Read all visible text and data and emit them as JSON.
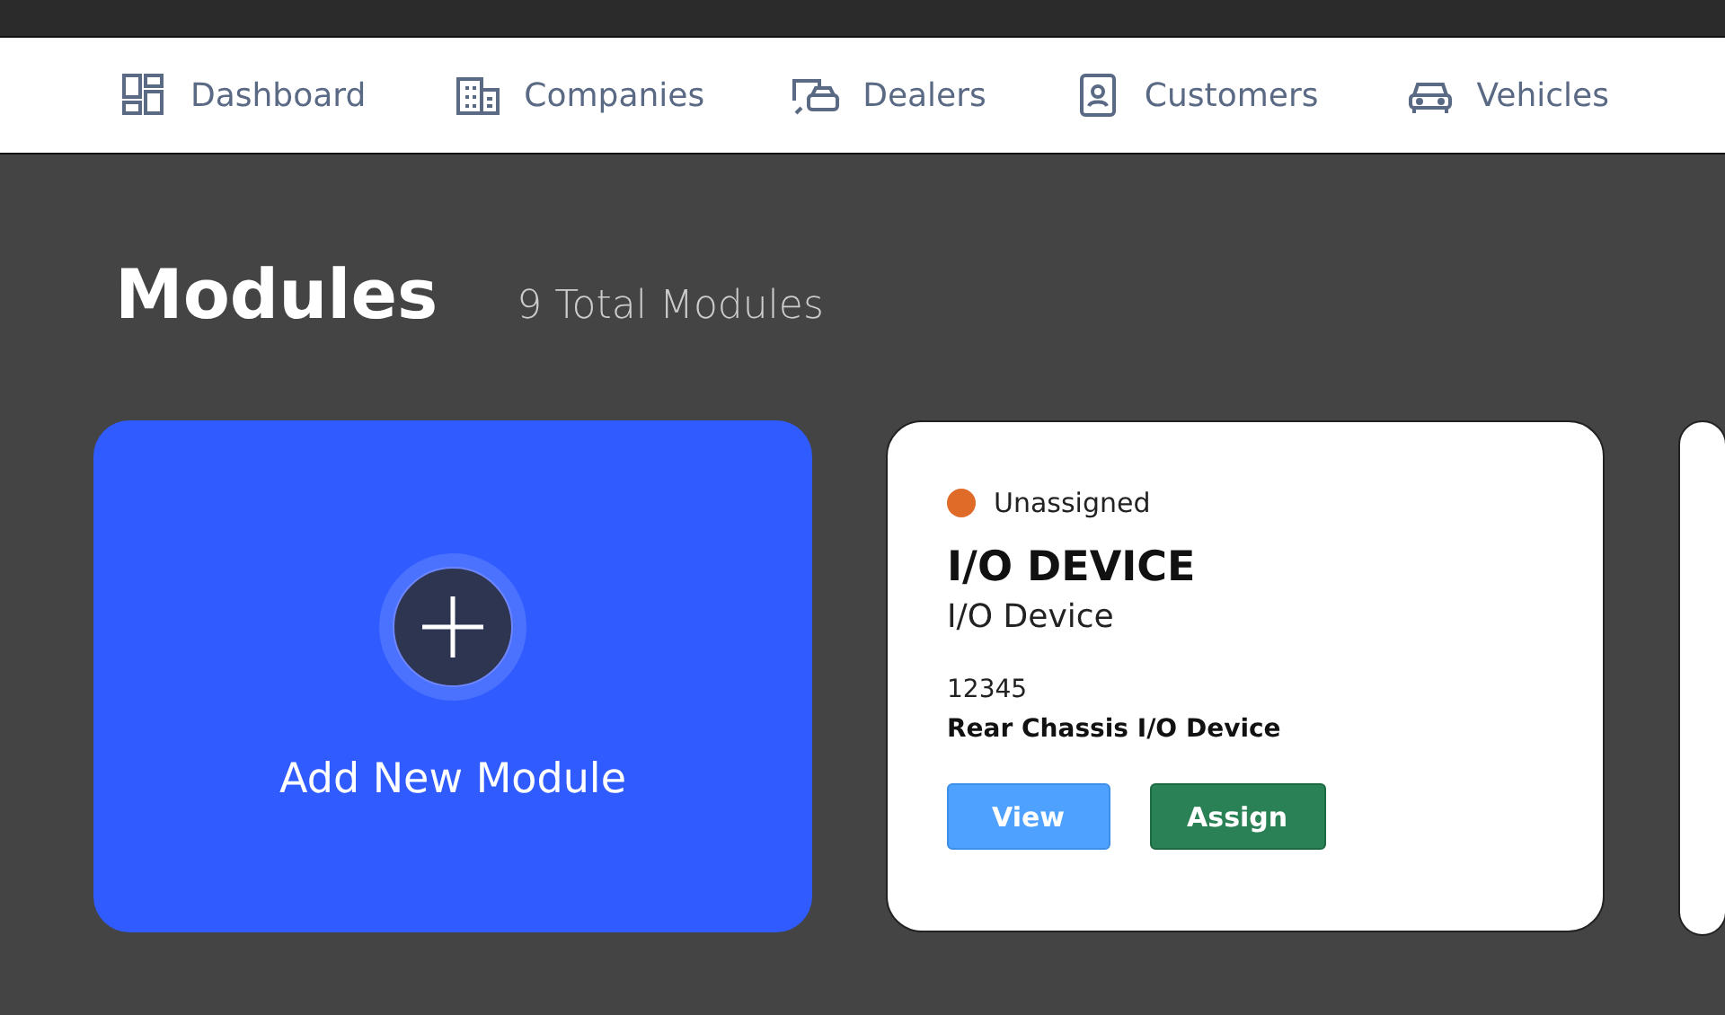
{
  "nav": [
    {
      "kind": "dashboard",
      "label": "Dashboard"
    },
    {
      "kind": "companies",
      "label": "Companies"
    },
    {
      "kind": "dealers",
      "label": "Dealers"
    },
    {
      "kind": "customers",
      "label": "Customers"
    },
    {
      "kind": "vehicles",
      "label": "Vehicles"
    }
  ],
  "page": {
    "title": "Modules",
    "count": "9 Total Modules"
  },
  "add_card": {
    "label": "Add New Module"
  },
  "modules": [
    {
      "status": "Unassigned",
      "color": "#e06a28",
      "name": "I/O DEVICE",
      "type": "I/O Device",
      "serial": "12345",
      "description": "Rear Chassis I/O Device",
      "buttons": [
        "View",
        "Assign"
      ]
    }
  ]
}
